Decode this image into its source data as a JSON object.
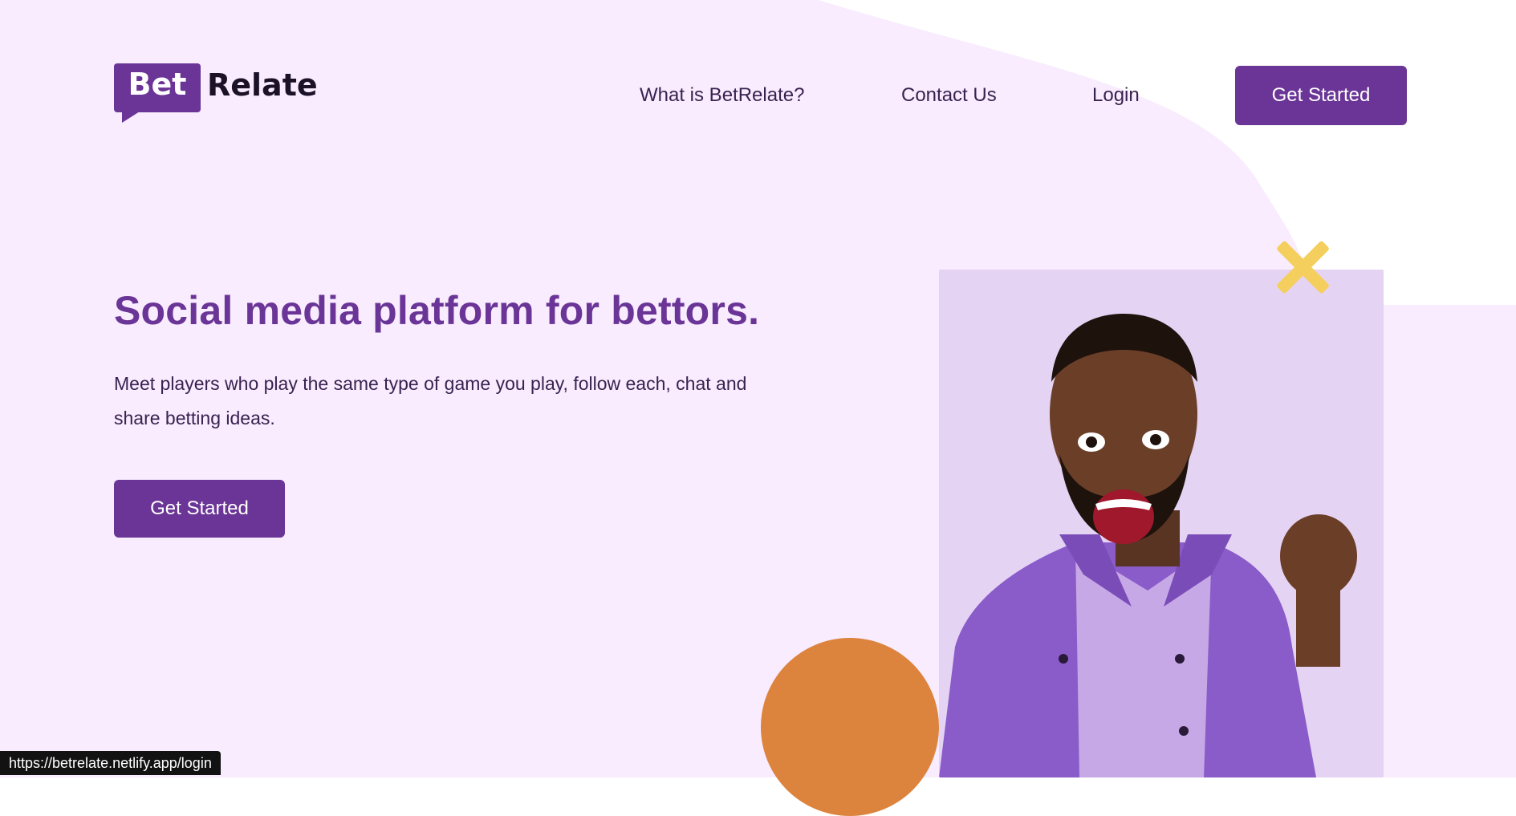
{
  "brand": {
    "logo_primary": "Bet",
    "logo_secondary": "Relate",
    "accent_color": "#6a3596",
    "background_color": "#f8ecfe"
  },
  "nav": {
    "links": [
      "What is BetRelate?",
      "Contact Us",
      "Login"
    ],
    "cta_label": "Get Started"
  },
  "hero": {
    "title": "Social media platform for bettors.",
    "description": "Meet players who play the same type of game you play, follow each, chat and share betting ideas.",
    "cta_label": "Get Started",
    "image": "excited-man-purple-jacket-fist-raised"
  },
  "decorations": {
    "cross_color": "#f5cf5d",
    "circle_color": "#dc843e"
  },
  "status_bar": {
    "url": "https://betrelate.netlify.app/login"
  }
}
